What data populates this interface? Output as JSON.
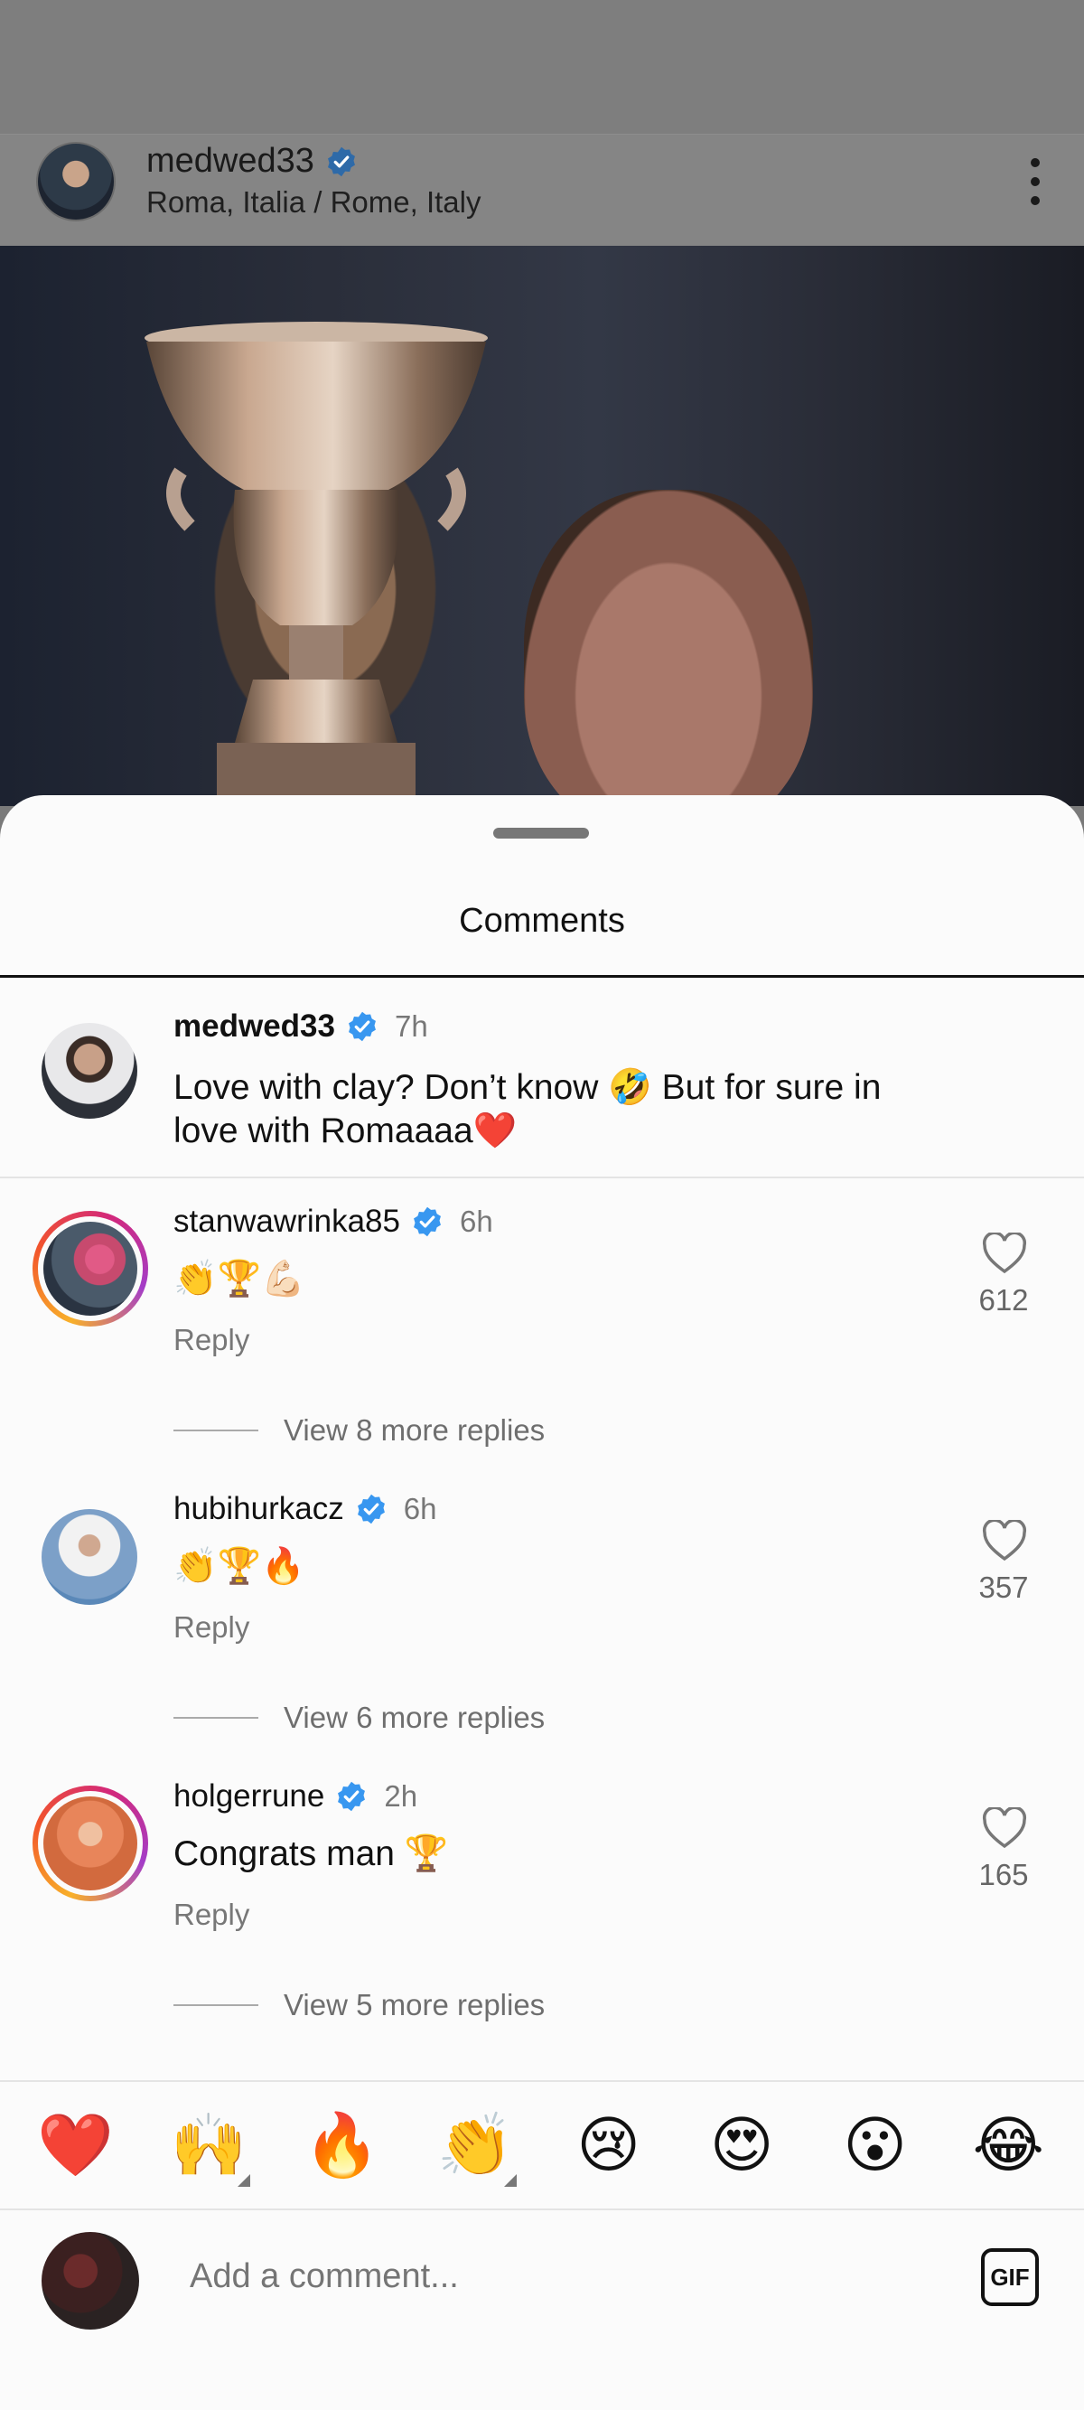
{
  "post_header": {
    "username": "medwed33",
    "location": "Roma, Italia / Rome, Italy"
  },
  "sheet": {
    "title": "Comments"
  },
  "caption": {
    "username": "medwed33",
    "time": "7h",
    "text_line1": "Love with clay? Don’t know 🤣 But for sure in",
    "text_line2": "love with Romaaaa❤️"
  },
  "comments": [
    {
      "username": "stanwawrinka85",
      "time": "6h",
      "text": "👏🏆💪🏻",
      "reply": "Reply",
      "likes": "612",
      "view_more": "View 8 more replies"
    },
    {
      "username": "hubihurkacz",
      "time": "6h",
      "text": "👏🏆🔥",
      "reply": "Reply",
      "likes": "357",
      "view_more": "View 6 more replies"
    },
    {
      "username": "holgerrune",
      "time": "2h",
      "text": "Congrats man 🏆",
      "reply": "Reply",
      "likes": "165",
      "view_more": "View 5 more replies"
    }
  ],
  "emoji_bar": [
    "❤️",
    "🙌",
    "🔥",
    "👏",
    "😢",
    "😍",
    "😮",
    "😂"
  ],
  "composer": {
    "placeholder": "Add a comment...",
    "gif_label": "GIF"
  },
  "colors": {
    "verified": "#3897f0",
    "muted_text": "#777777",
    "dim_overlay": "#7e7e7e"
  }
}
